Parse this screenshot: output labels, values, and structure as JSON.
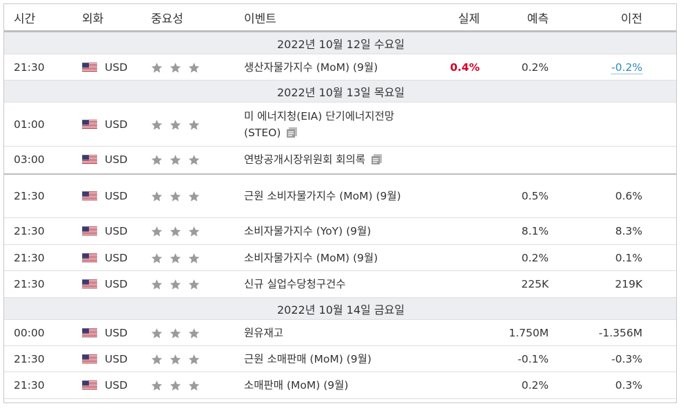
{
  "header": {
    "time": "시간",
    "currency": "외화",
    "importance": "중요성",
    "event": "이벤트",
    "actual": "실제",
    "forecast": "예측",
    "previous": "이전"
  },
  "colors": {
    "actual_red": "#d8002a",
    "revised_blue": "#2a8ab8",
    "star_gray": "#9b9b9b",
    "date_bg": "#eceef1"
  },
  "groups": [
    {
      "date": "2022년 10월 12일 수요일",
      "rows": [
        {
          "time": "21:30",
          "currency": "USD",
          "event": "생산자물가지수 (MoM) (9월)",
          "actual": "0.4%",
          "forecast": "0.2%",
          "previous": "-0.2%"
        }
      ]
    },
    {
      "date": "2022년 10월 13일 목요일",
      "rows": [
        {
          "time": "01:00",
          "currency": "USD",
          "event": "미 에너지청(EIA) 단기에너지전망(STEO)",
          "actual": "",
          "forecast": "",
          "previous": ""
        },
        {
          "time": "03:00",
          "currency": "USD",
          "event": "연방공개시장위원회 회의록",
          "actual": "",
          "forecast": "",
          "previous": ""
        },
        {
          "time": "21:30",
          "currency": "USD",
          "event": "근원 소비자물가지수 (MoM) (9월)",
          "actual": "",
          "forecast": "0.5%",
          "previous": "0.6%"
        },
        {
          "time": "21:30",
          "currency": "USD",
          "event": "소비자물가지수 (YoY) (9월)",
          "actual": "",
          "forecast": "8.1%",
          "previous": "8.3%"
        },
        {
          "time": "21:30",
          "currency": "USD",
          "event": "소비자물가지수 (MoM) (9월)",
          "actual": "",
          "forecast": "0.2%",
          "previous": "0.1%"
        },
        {
          "time": "21:30",
          "currency": "USD",
          "event": "신규 실업수당청구건수",
          "actual": "",
          "forecast": "225K",
          "previous": "219K"
        }
      ]
    },
    {
      "date": "2022년 10월 14일 금요일",
      "rows": [
        {
          "time": "00:00",
          "currency": "USD",
          "event": "원유재고",
          "actual": "",
          "forecast": "1.750M",
          "previous": "-1.356M"
        },
        {
          "time": "21:30",
          "currency": "USD",
          "event": "근원 소매판매 (MoM) (9월)",
          "actual": "",
          "forecast": "-0.1%",
          "previous": "-0.3%"
        },
        {
          "time": "21:30",
          "currency": "USD",
          "event": "소매판매 (MoM) (9월)",
          "actual": "",
          "forecast": "0.2%",
          "previous": "0.3%"
        }
      ]
    }
  ]
}
